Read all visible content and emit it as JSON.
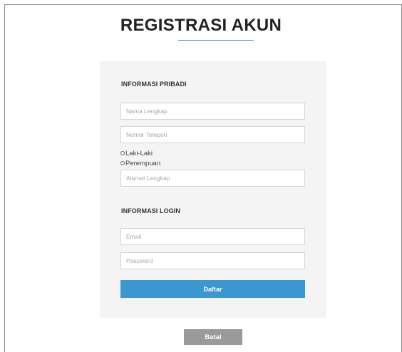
{
  "page": {
    "title": "REGISTRASI AKUN"
  },
  "form": {
    "personal_section_title": "INFORMASI PRIBADI",
    "full_name_placeholder": "Nama Lengkap",
    "phone_placeholder": "Nomor Telepon",
    "gender_options": [
      "Laki-Laki",
      "Perempuan"
    ],
    "address_placeholder": "Alamat Lengkap",
    "login_section_title": "INFORMASI LOGIN",
    "email_placeholder": "Email",
    "password_placeholder": "Password",
    "submit_label": "Daftar",
    "cancel_label": "Batal"
  },
  "colors": {
    "accent": "#3a97cf",
    "panel_bg": "#f4f4f5",
    "cancel_bg": "#9a9a9a"
  }
}
